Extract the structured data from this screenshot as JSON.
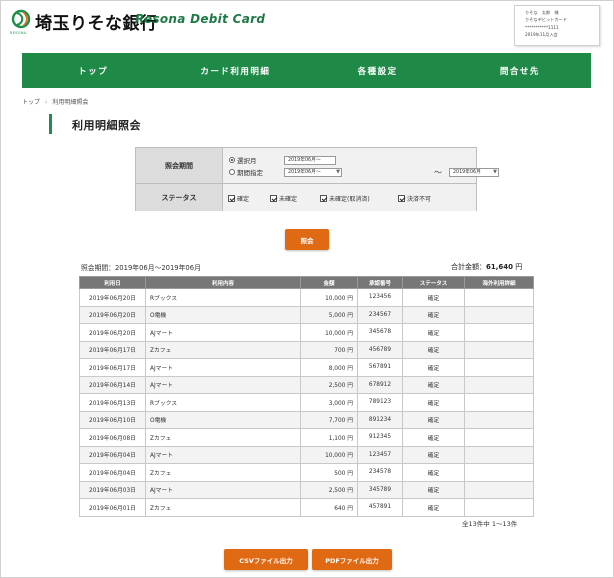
{
  "header": {
    "logo_sub": "RESONA",
    "bank_name": "埼玉りそな銀行",
    "card_name": "Resona Debit Card",
    "user_lines": [
      "りそな　太郎　様",
      "りそなデビットカード",
      "***********1111",
      "2019年11月入会"
    ]
  },
  "nav": {
    "items": [
      "トップ",
      "カード利用明細",
      "各種設定",
      "問合せ先"
    ]
  },
  "breadcrumb": [
    "トップ",
    "利用明細照会"
  ],
  "page_title": "利用明細照会",
  "form": {
    "period_label": "照会期間",
    "radio_month": "選択月",
    "radio_range": "期間指定",
    "month_value": "2019年06月～",
    "range_from": "2019年06月～",
    "range_to": "2019年06月",
    "tilde": "～",
    "status_label": "ステータス",
    "statuses": [
      "確定",
      "未確定",
      "未確定(取消済)",
      "決済不可"
    ]
  },
  "search_button": "照会",
  "period_text": "照会期間：2019年06月～2019年06月",
  "total": {
    "label": "合計金額：",
    "amount": "61,640",
    "unit": "円"
  },
  "table": {
    "headers": [
      "利用日",
      "利用内容",
      "金額",
      "承認番号",
      "ステータス",
      "海外利用詳細"
    ],
    "rows": [
      [
        "2019年06月20日",
        "Rブックス",
        "10,000 円",
        "123456",
        "確定",
        ""
      ],
      [
        "2019年06月20日",
        "O電機",
        "5,000 円",
        "234567",
        "確定",
        ""
      ],
      [
        "2019年06月20日",
        "AJマート",
        "10,000 円",
        "345678",
        "確定",
        ""
      ],
      [
        "2019年06月17日",
        "Zカフェ",
        "700 円",
        "456789",
        "確定",
        ""
      ],
      [
        "2019年06月17日",
        "AJマート",
        "8,000 円",
        "567891",
        "確定",
        ""
      ],
      [
        "2019年06月14日",
        "AJマート",
        "2,500 円",
        "678912",
        "確定",
        ""
      ],
      [
        "2019年06月13日",
        "Rブックス",
        "3,000 円",
        "789123",
        "確定",
        ""
      ],
      [
        "2019年06月10日",
        "O電機",
        "7,700 円",
        "891234",
        "確定",
        ""
      ],
      [
        "2019年06月08日",
        "Zカフェ",
        "1,100 円",
        "912345",
        "確定",
        ""
      ],
      [
        "2019年06月04日",
        "AJマート",
        "10,000 円",
        "123457",
        "確定",
        ""
      ],
      [
        "2019年06月04日",
        "Zカフェ",
        "500 円",
        "234578",
        "確定",
        ""
      ],
      [
        "2019年06月03日",
        "AJマート",
        "2,500 円",
        "345789",
        "確定",
        ""
      ],
      [
        "2019年06月01日",
        "Zカフェ",
        "640 円",
        "457891",
        "確定",
        ""
      ]
    ]
  },
  "count_text": "全13件中 1～13件",
  "buttons": {
    "csv": "CSVファイル出力",
    "pdf": "PDFファイル出力"
  },
  "colors": {
    "brand_green": "#1f8a47",
    "accent_orange": "#e06a14",
    "table_header": "#777777"
  }
}
